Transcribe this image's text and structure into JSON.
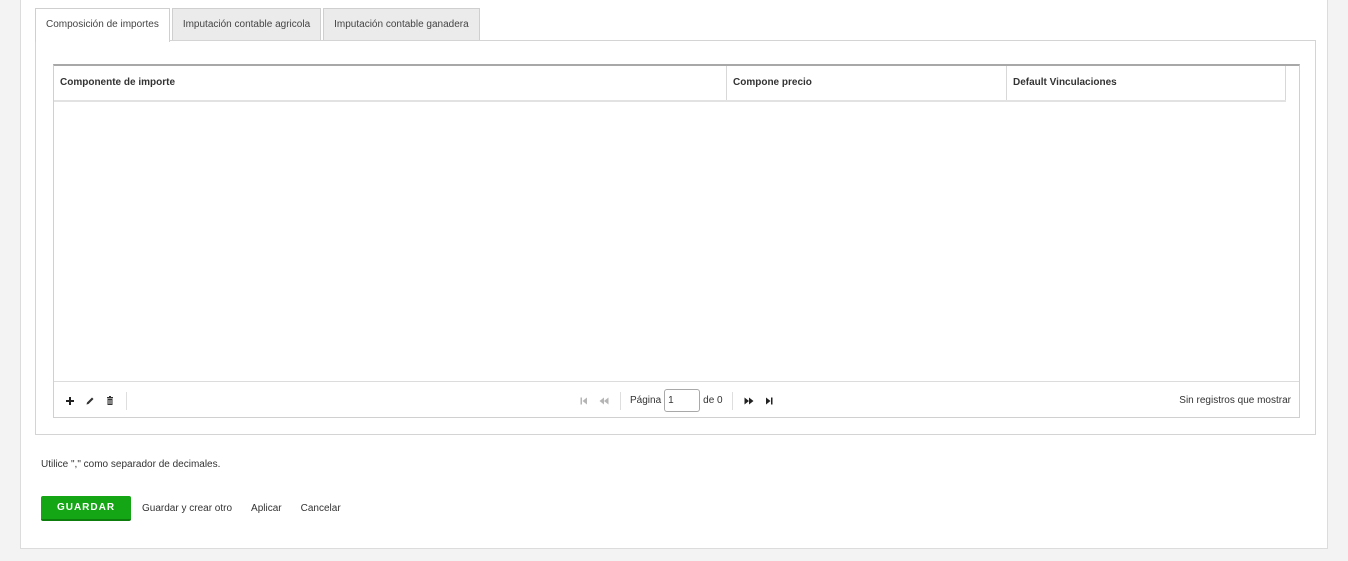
{
  "tabs": [
    {
      "label": "Composición de importes",
      "active": true
    },
    {
      "label": "Imputación contable agricola",
      "active": false
    },
    {
      "label": "Imputación contable ganadera",
      "active": false
    }
  ],
  "grid": {
    "columns": [
      "Componente de importe",
      "Compone precio",
      "Default Vinculaciones"
    ],
    "rows": []
  },
  "pager": {
    "toolbar_icons": [
      "add-icon",
      "edit-icon",
      "delete-icon"
    ],
    "page_label": "Página",
    "page_value": "1",
    "of_label": "de 0",
    "status": "Sin registros que mostrar"
  },
  "note": "Utilice \",\" como separador de decimales.",
  "actions": {
    "save": "GUARDAR",
    "save_and_new": "Guardar y crear otro",
    "apply": "Aplicar",
    "cancel": "Cancelar"
  },
  "colors": {
    "primary": "#14a614",
    "background": "#f3f3f3"
  }
}
